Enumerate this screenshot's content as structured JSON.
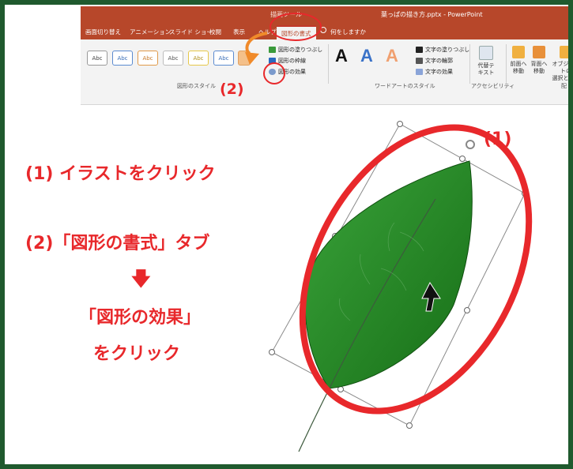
{
  "ribbon": {
    "context_tool": "描画ツール",
    "file_title": "葉っぱの描き方.pptx - PowerPoint",
    "tabs": [
      "画面切り替え",
      "アニメーション",
      "スライド ショー",
      "校閲",
      "表示",
      "ヘルプ"
    ],
    "active_tab": "図形の書式",
    "tell_me": "何をしますか",
    "style_swatches": [
      "Abc",
      "Abc",
      "Abc",
      "Abc",
      "Abc",
      "Abc"
    ],
    "shape_fill": "図形の塗りつぶし",
    "shape_outline": "図形の枠線",
    "shape_effects": "図形の効果",
    "group_shape_styles": "図形のスタイル",
    "wordart_letters": [
      "A",
      "A",
      "A"
    ],
    "text_fill": "文字の塗りつぶし",
    "text_outline": "文字の輪郭",
    "text_effects": "文字の効果",
    "group_wordart": "ワードアートのスタイル",
    "alt_text": [
      "代替テ",
      "キスト"
    ],
    "group_accessibility": "アクセシビリティ",
    "bring_forward": [
      "前面へ",
      "移動"
    ],
    "send_backward": [
      "背面へ",
      "移動"
    ],
    "selection_pane": [
      "オブジェクトの",
      "選択と表示"
    ],
    "group_arrange_partial": "配"
  },
  "annotations": {
    "label_2_ribbon": "(2)",
    "label_1_leaf": "(1)",
    "step1": "(1) イラストをクリック",
    "step2": "(2)「図形の書式」タブ",
    "arrow_down": "🡇",
    "step3_line1": "「図形の効果」",
    "step3_line2": "をクリック"
  },
  "colors": {
    "annotation_red": "#e8282b",
    "leaf_green": "#2a8a2a",
    "ribbon_accent": "#b7472a",
    "frame_green": "#1f5a2e"
  }
}
